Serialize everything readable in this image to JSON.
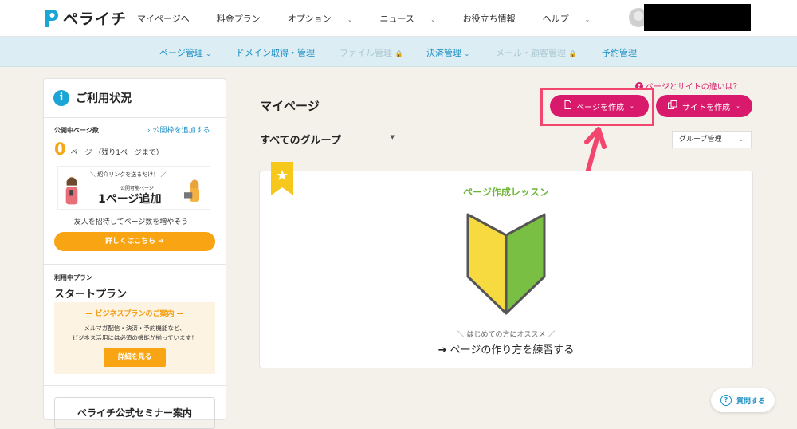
{
  "header": {
    "logo_text": "ペライチ",
    "nav": [
      {
        "label": "マイページへ",
        "dropdown": false
      },
      {
        "label": "料金プラン",
        "dropdown": false
      },
      {
        "label": "オプション",
        "dropdown": true
      },
      {
        "label": "ニュース",
        "dropdown": true
      },
      {
        "label": "お役立ち情報",
        "dropdown": false
      },
      {
        "label": "ヘルプ",
        "dropdown": true
      }
    ]
  },
  "subnav": {
    "items": [
      {
        "label": "ページ管理",
        "suffix": "⌄",
        "disabled": false
      },
      {
        "label": "ドメイン取得・管理",
        "suffix": "",
        "disabled": false
      },
      {
        "label": "ファイル管理",
        "suffix": "🔒",
        "disabled": true
      },
      {
        "label": "決済管理",
        "suffix": "⌄",
        "disabled": false
      },
      {
        "label": "メール・顧客管理",
        "suffix": "🔒",
        "disabled": true
      },
      {
        "label": "予約管理",
        "suffix": "",
        "disabled": false
      }
    ]
  },
  "sidebar": {
    "title": "ご利用状況",
    "published_label": "公開中ページ数",
    "add_link": "› 公開枠を追加する",
    "count": "0",
    "count_text": "ページ （残り1ページまで）",
    "banner": {
      "head": "＼ 紹介リンクを送るだけ！ ／",
      "sub": "公開可能ページ",
      "main": "1ページ追加"
    },
    "invite_text": "友人を招待してページ数を増やそう！",
    "details_button": "詳しくはこちら ➔",
    "plan_label": "利用中プラン",
    "plan_name": "スタートプラン",
    "biz_head": "— ビジネスプランのご案内 —",
    "biz_desc_1": "メルマガ配信・決済・予約機能など、",
    "biz_desc_2": "ビジネス活用には必須の機能が揃っています！",
    "biz_button": "詳細を見る",
    "seminar": "ペライチ公式セミナー案内"
  },
  "main": {
    "help_link": "ページとサイトの違いは？",
    "title": "マイページ",
    "create_page_button": "ページを作成",
    "create_site_button": "サイトを作成",
    "group_select": "すべてのグループ",
    "group_mgmt": "グループ管理",
    "lesson": {
      "title": "ページ作成レッスン",
      "sub": "＼ はじめての方にオススメ ／",
      "cta": "ページの作り方を練習する"
    },
    "question_button": "質問する"
  },
  "colors": {
    "accent_pink": "#d91a6c",
    "highlight_red": "#f2466f",
    "orange": "#f9a412",
    "link_blue": "#1c8fc4",
    "lesson_green": "#6cb536"
  }
}
